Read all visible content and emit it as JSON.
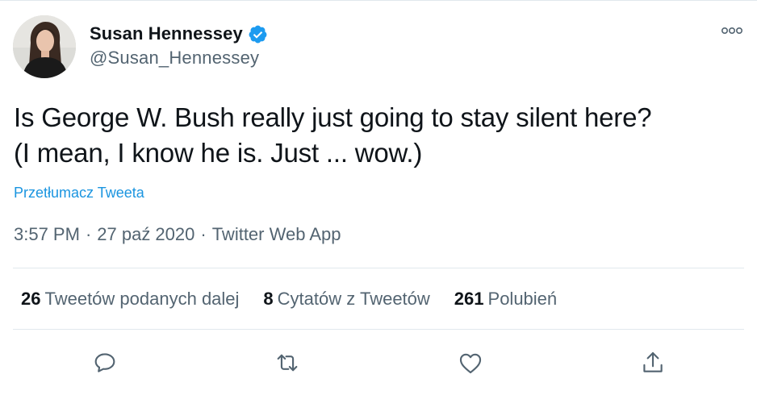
{
  "tweet": {
    "author": {
      "display_name": "Susan Hennessey",
      "handle": "@Susan_Hennessey",
      "verified": true
    },
    "text_lines": [
      "Is George W. Bush really just going to stay silent here?",
      "(I mean, I know he is. Just ... wow.)"
    ],
    "translate_label": "Przetłumacz Tweeta",
    "time": "3:57 PM",
    "date": "27 paź 2020",
    "source": "Twitter Web App",
    "separator": "·"
  },
  "stats": {
    "retweets": {
      "count": "26",
      "label": "Tweetów podanych dalej"
    },
    "quotes": {
      "count": "8",
      "label": "Cytatów z Tweetów"
    },
    "likes": {
      "count": "261",
      "label": "Polubień"
    }
  },
  "icons": {
    "verified": "verified-badge-icon",
    "more": "more-options-icon",
    "reply": "reply-icon",
    "retweet": "retweet-icon",
    "like": "heart-icon",
    "share": "share-icon"
  },
  "colors": {
    "accent": "#1b95e0",
    "verified": "#1d9bf0",
    "text": "#0f1419",
    "secondary": "#536471",
    "border": "#e1e8ed"
  }
}
